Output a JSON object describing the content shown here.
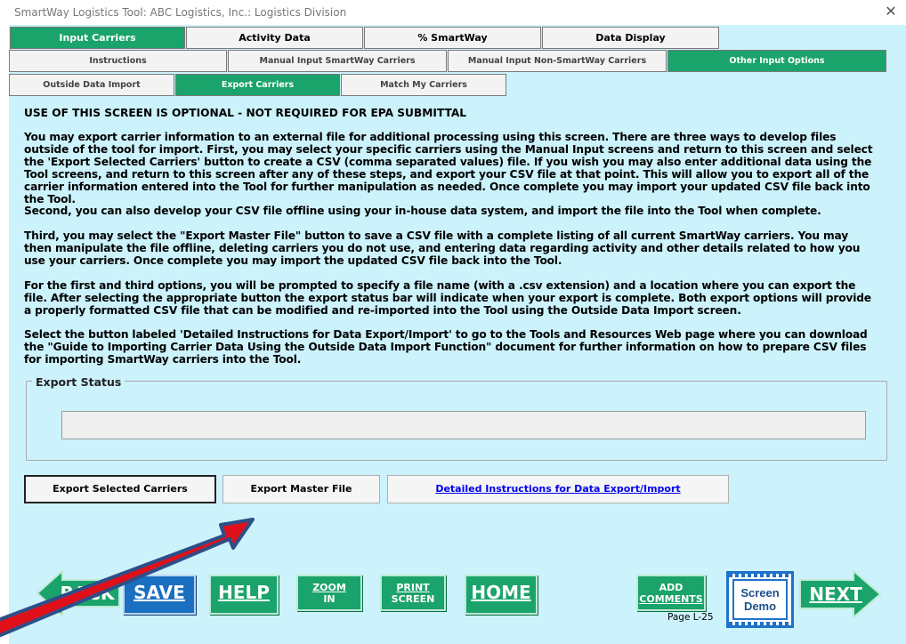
{
  "window": {
    "title": "SmartWay Logistics Tool: ABC Logistics, Inc.: Logistics Division",
    "close": "✕"
  },
  "tabs_row1": [
    "Input Carriers",
    "Activity Data",
    "% SmartWay",
    "Data Display"
  ],
  "tabs_row2": [
    "Instructions",
    "Manual Input SmartWay Carriers",
    "Manual Input Non-SmartWay Carriers",
    "Other Input Options"
  ],
  "tabs_row3": [
    "Outside Data Import",
    "Export Carriers",
    "Match My Carriers"
  ],
  "content": {
    "heading": "USE OF THIS SCREEN IS OPTIONAL - NOT REQUIRED FOR EPA SUBMITTAL",
    "p1": "You may export carrier information to an external file for additional processing using this screen. There are three ways to develop files outside of the tool for import. First, you may select your specific carriers using the Manual Input screens and return to this screen and select the 'Export Selected Carriers' button to create a CSV (comma separated values) file.  If you wish you may also enter additional data using the Tool screens, and return to this screen after any of these steps, and export your CSV file at that point.  This will allow you to export all of the carrier information entered into the Tool for further manipulation as needed.  Once complete you may import your updated CSV file back into the Tool.",
    "p2": "Second, you can also develop your CSV file offline using your in-house data system, and import the file into the Tool when complete.",
    "p3": "Third, you may select the \"Export Master File\" button to save a CSV file with a complete listing of all current SmartWay carriers.  You may then manipulate the file offline, deleting carriers you do not use, and entering data regarding activity and other details related to how you use your carriers. Once complete you may import the updated CSV file back into the Tool.",
    "p4": "For the first and third options, you will be prompted to specify a file name (with a .csv extension) and a location where you can export the file.  After selecting the appropriate button the export status bar will indicate when your export is complete.  Both export options will provide a properly formatted CSV file that can be modified and re-imported into the Tool using the Outside Data Import screen.",
    "p5": "Select the button labeled 'Detailed Instructions for Data Export/Import' to go to the Tools and Resources Web page where you can download the \"Guide to Importing Carrier Data Using the Outside Data Import Function\" document for further information on how to prepare CSV files for importing SmartWay carriers into the Tool."
  },
  "export_status": {
    "label": "Export Status",
    "progress": 0
  },
  "buttons": {
    "export_selected": "Export Selected Carriers",
    "export_master": "Export Master File",
    "instructions_link": "Detailed Instructions for Data Export/Import"
  },
  "nav": {
    "back": "BACK",
    "save": "SAVE",
    "help": "HELP",
    "zoom1": "ZOOM",
    "zoom2": "IN",
    "print1": "PRINT",
    "print2": "SCREEN",
    "home": "HOME",
    "comments1": "ADD",
    "comments2": "COMMENTS",
    "demo1": "Screen",
    "demo2": "Demo",
    "next": "NEXT"
  },
  "page_label": "Page L-25",
  "colors": {
    "accent_green": "#1aa36a",
    "save_blue": "#1a6fc0",
    "background": "#ccf2fb",
    "arrow_red": "#e0101a",
    "arrow_outline": "#2d4f88"
  }
}
